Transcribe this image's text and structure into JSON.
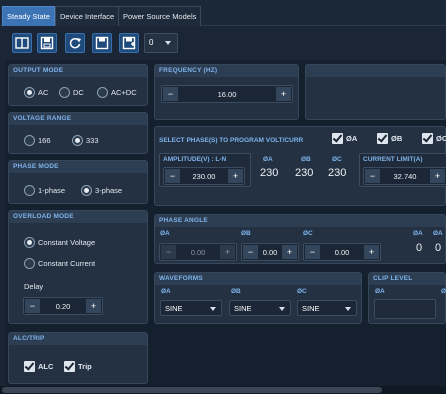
{
  "tabs": [
    "Steady State",
    "Device Interface",
    "Power Source Models"
  ],
  "toolbar": {
    "buttons": [
      "panels-icon",
      "save-icon",
      "refresh-icon",
      "disk-icon",
      "disk-plus-icon"
    ],
    "combo_value": "0"
  },
  "output_mode": {
    "title": "OUTPUT MODE",
    "options": [
      "AC",
      "DC",
      "AC+DC"
    ],
    "selected": "AC"
  },
  "voltage_range": {
    "title": "VOLTAGE RANGE",
    "options": [
      "166",
      "333"
    ],
    "selected": "333"
  },
  "phase_mode": {
    "title": "PHASE MODE",
    "options": [
      "1-phase",
      "3-phase"
    ],
    "selected": "3-phase"
  },
  "overload_mode": {
    "title": "OVERLOAD MODE",
    "options": [
      "Constant Voltage",
      "Constant Current"
    ],
    "selected": "Constant Voltage",
    "delay_label": "Delay",
    "delay_value": "0.20"
  },
  "alc_trip": {
    "title": "ALC/TRIP",
    "alc_label": "ALC",
    "trip_label": "Trip"
  },
  "frequency": {
    "title": "FREQUENCY (HZ)",
    "value": "16.00"
  },
  "select_phase": {
    "title": "SELECT PHASE(S) TO PROGRAM VOLT/CURR",
    "checks": [
      "ØA",
      "ØB",
      "ØC"
    ]
  },
  "amplitude": {
    "label": "AMPLITUDE(V) : L-N",
    "value": "230.00",
    "phase_labels": [
      "ØA",
      "ØB",
      "ØC"
    ],
    "phase_values": [
      "230",
      "230",
      "230"
    ]
  },
  "current_limit": {
    "label": "CURRENT LIMIT(A)",
    "value": "32.740"
  },
  "phase_angle": {
    "title": "PHASE ANGLE",
    "labels": [
      "ØA",
      "ØB",
      "ØC"
    ],
    "values": [
      "0.00",
      "0.00",
      "0.00"
    ],
    "readout_labels": [
      "ØA",
      "ØA"
    ],
    "readout_values": [
      "0",
      "0"
    ]
  },
  "waveforms": {
    "title": "WAVEFORMS",
    "labels": [
      "ØA",
      "ØB",
      "ØC"
    ],
    "values": [
      "SINE",
      "SINE",
      "SINE"
    ]
  },
  "clip_level": {
    "title": "CLIP LEVEL",
    "labels": [
      "ØA",
      "ØB"
    ]
  }
}
